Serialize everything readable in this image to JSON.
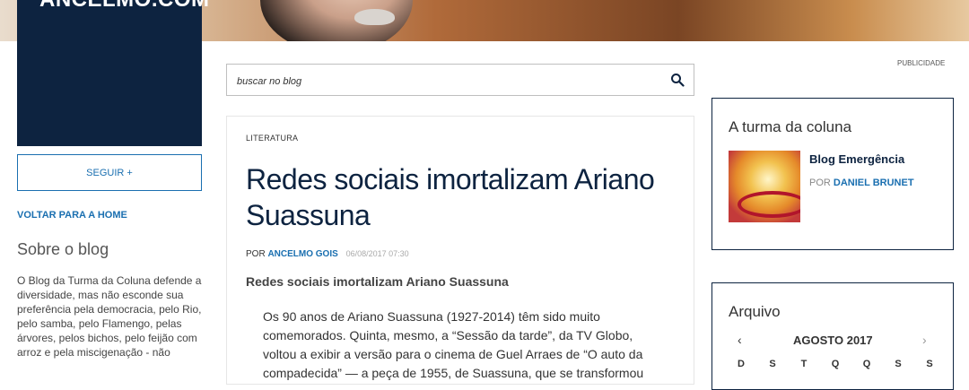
{
  "header": {
    "logo_text": "ANCELMO.COM"
  },
  "sidebar": {
    "follow_label": "SEGUIR +",
    "back_home_label": "VOLTAR PARA A HOME",
    "about_title": "Sobre o blog",
    "about_text": "O Blog da Turma da Coluna defende a diversidade, mas não esconde sua preferência pela democracia, pelo Rio, pelo samba, pelo Flamengo, pelas árvores, pelos bichos, pelo feijão com arroz e pela miscigenação - não"
  },
  "search": {
    "placeholder": "buscar no blog",
    "icon": "search-icon"
  },
  "article": {
    "category": "LITERATURA",
    "title": "Redes sociais imortalizam Ariano Suassuna",
    "by_prefix": "POR",
    "author": "ANCELMO GOIS",
    "date": "06/08/2017 07:30",
    "lead": "Redes sociais imortalizam Ariano Suassuna",
    "body": "Os 90 anos de Ariano Suassuna (1927-2014) têm sido muito comemorados. Quinta, mesmo, a “Sessão da tarde”, da TV Globo, voltou a exibir a versão para o cinema de Guel Arraes de “O auto da compadecida” — a peça de 1955, de Suassuna, que se transformou"
  },
  "right": {
    "ad_label": "PUBLICIDADE",
    "team": {
      "title": "A turma da coluna",
      "blog_name": "Blog Emergência",
      "by_prefix": "POR",
      "author": "DANIEL BRUNET"
    },
    "archive": {
      "title": "Arquivo",
      "prev": "‹",
      "next": "›",
      "month": "AGOSTO 2017",
      "weekdays": [
        "D",
        "S",
        "T",
        "Q",
        "Q",
        "S",
        "S"
      ]
    }
  }
}
